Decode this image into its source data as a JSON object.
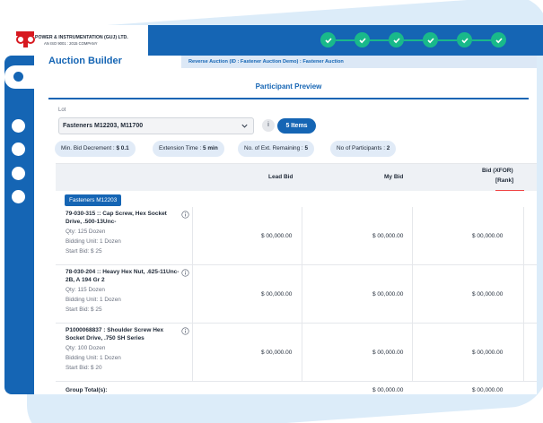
{
  "company": {
    "name": "POWER & INSTRUMENTATION (GUJ) LTD.",
    "tagline": "AN ISO 9001 : 2015 COMPANY"
  },
  "colors": {
    "brand": "#1565b4",
    "step_done": "#19b98a"
  },
  "steps": [
    "check-icon",
    "check-icon",
    "check-icon",
    "check-icon",
    "check-icon",
    "check-icon"
  ],
  "page": {
    "title": "Auction Builder",
    "breadcrumb": "Reverse Auction (ID : Fastener Auction Demo) : Fastener Auction",
    "tab": "Participant Preview"
  },
  "lot": {
    "label": "Lot",
    "selected": "Fasteners M12203, M11700",
    "info": "i",
    "items_button": "5 Items"
  },
  "chips": [
    {
      "label": "Min. Bid Decrement :",
      "value": "$ 0.1"
    },
    {
      "label": "Extension Time :",
      "value": "5 min"
    },
    {
      "label": "No. of Ext. Remaining :",
      "value": "5"
    },
    {
      "label": "No of Participants :",
      "value": "2"
    }
  ],
  "table": {
    "headers": {
      "lead_bid": "Lead Bid",
      "my_bid": "My Bid",
      "bid_xfor": "Bid (XFOR)",
      "rank": "[Rank]"
    },
    "group": "Fasteners M12203",
    "rows": [
      {
        "title": "79-030-315 :: Cap Screw, Hex Socket Drive, .500-13Unc-",
        "qty": "Qty: 125 Dozen",
        "bidding_unit": "Bidding Unit: 1 Dozen",
        "start_bid": "Start Bid: $ 25",
        "lead_bid": "$ 00,000.00",
        "my_bid": "$ 00,000.00",
        "bid_xfor": "$ 00,000.00"
      },
      {
        "title": "78-030-204 :: Heavy Hex Nut, .625-11Unc-2B, A 194 Gr 2",
        "qty": "Qty: 115 Dozen",
        "bidding_unit": "Bidding Unit: 1 Dozen",
        "start_bid": "Start Bid: $ 25",
        "lead_bid": "$ 00,000.00",
        "my_bid": "$ 00,000.00",
        "bid_xfor": "$ 00,000.00"
      },
      {
        "title": "P1000068837 : Shoulder Screw Hex Socket Drive, .750 SH Series",
        "qty": "Qty: 100 Dozen",
        "bidding_unit": "Bidding Unit: 1 Dozen",
        "start_bid": "Start Bid: $ 20",
        "lead_bid": "$ 00,000.00",
        "my_bid": "$ 00,000.00",
        "bid_xfor": "$ 00,000.00"
      }
    ],
    "total": {
      "label": "Group Total(s):",
      "my_bid": "$ 00,000.00",
      "bid_xfor": "$ 00,000.00"
    }
  }
}
